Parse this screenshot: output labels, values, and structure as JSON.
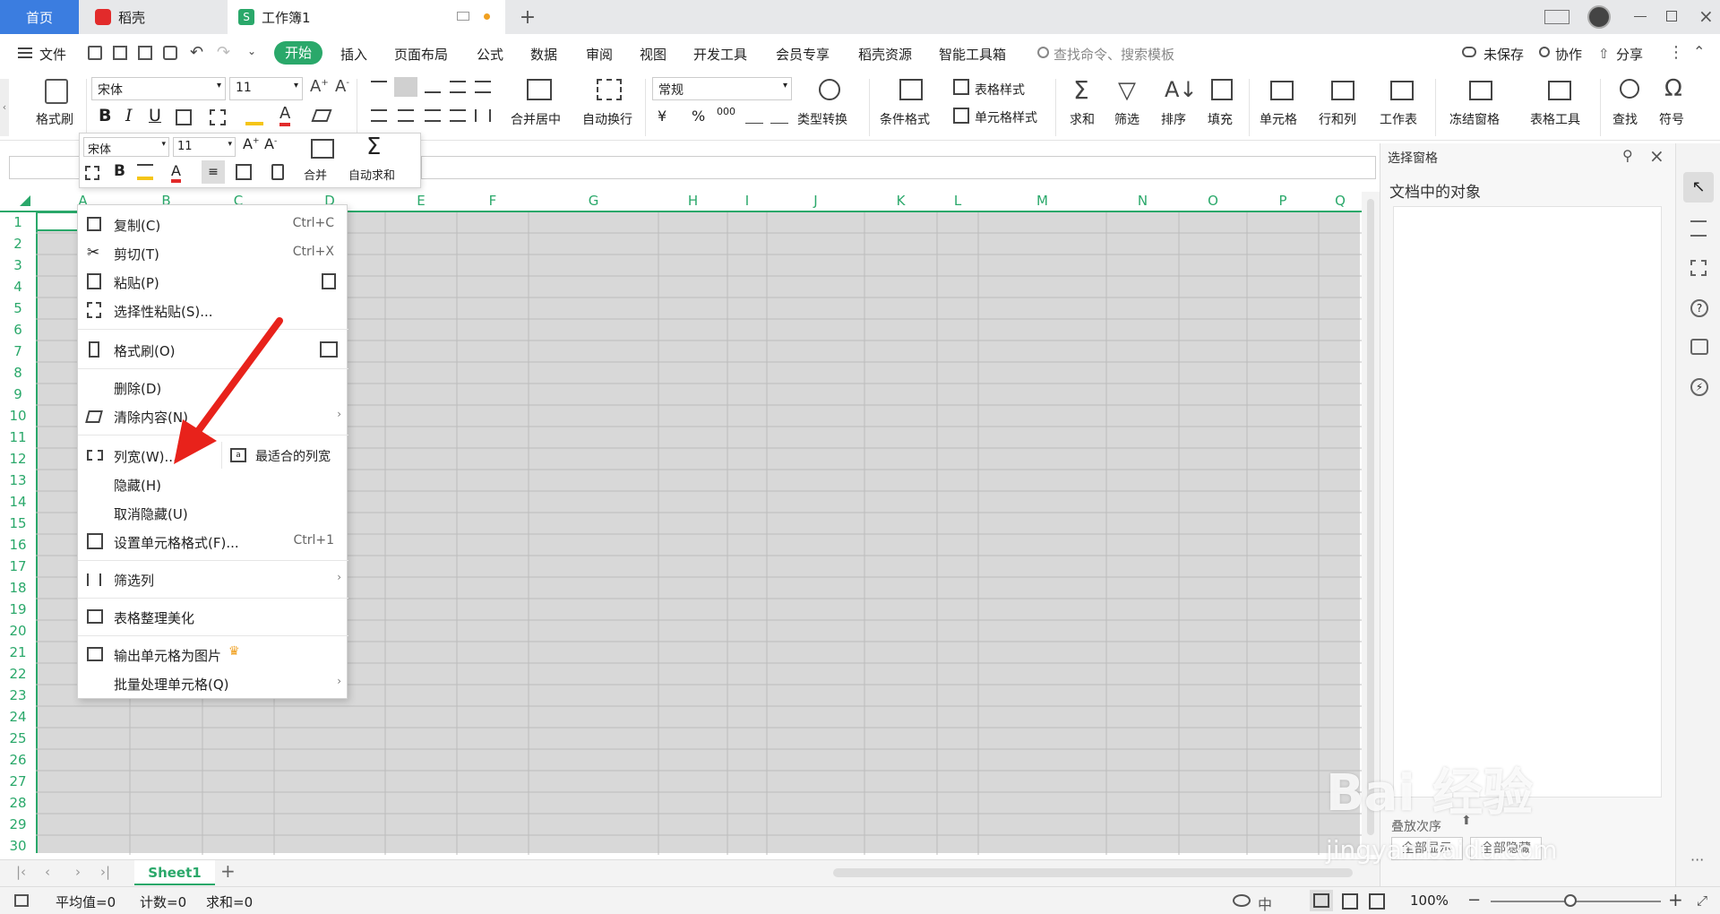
{
  "tabs": {
    "home": "首页",
    "daoke": "稻壳",
    "workbook": "工作簿1"
  },
  "menu": {
    "file": "文件",
    "start": "开始",
    "insert": "插入",
    "layout": "页面布局",
    "formula": "公式",
    "data": "数据",
    "review": "审阅",
    "view": "视图",
    "dev": "开发工具",
    "member": "会员专享",
    "daoke_res": "稻壳资源",
    "smart": "智能工具箱",
    "search": "查找命令、搜索模板",
    "unsaved": "未保存",
    "collab": "协作",
    "share": "分享"
  },
  "ribbon": {
    "brush": "格式刷",
    "font": "宋体",
    "size": "11",
    "merge": "合并居中",
    "wrap": "自动换行",
    "numfmt": "常规",
    "convert": "类型转换",
    "cond": "条件格式",
    "tablestyle": "表格样式",
    "cellstyle": "单元格样式",
    "sum": "求和",
    "filter": "筛选",
    "sort": "排序",
    "fill": "填充",
    "cell": "单元格",
    "rowcol": "行和列",
    "sheet": "工作表",
    "freeze": "冻结窗格",
    "tabletool": "表格工具",
    "find": "查找",
    "symbol": "符号",
    "currency": "¥",
    "percent": "%",
    "thousand": "000"
  },
  "mini": {
    "font": "宋体",
    "size": "11",
    "merge": "合并",
    "autosum": "自动求和"
  },
  "columns": [
    "A",
    "B",
    "C",
    "D",
    "E",
    "F",
    "G",
    "H",
    "I",
    "J",
    "K",
    "L",
    "M",
    "N",
    "O",
    "P",
    "Q"
  ],
  "rows": [
    "1",
    "2",
    "3",
    "4",
    "5",
    "6",
    "7",
    "8",
    "9",
    "10",
    "11",
    "12",
    "13",
    "14",
    "15",
    "16",
    "17",
    "18",
    "19",
    "20",
    "21",
    "22",
    "23",
    "24",
    "25",
    "26",
    "27",
    "28",
    "29",
    "30"
  ],
  "context_menu": {
    "copy": "复制(C)",
    "copy_sc": "Ctrl+C",
    "cut": "剪切(T)",
    "cut_sc": "Ctrl+X",
    "paste": "粘贴(P)",
    "paste_special": "选择性粘贴(S)...",
    "brush": "格式刷(O)",
    "delete": "删除(D)",
    "clear": "清除内容(N)",
    "col_width": "列宽(W)...",
    "best_fit": "最适合的列宽",
    "hide": "隐藏(H)",
    "unhide": "取消隐藏(U)",
    "cell_format": "设置单元格格式(F)...",
    "cell_format_sc": "Ctrl+1",
    "filter_col": "筛选列",
    "beautify": "表格整理美化",
    "export_img": "输出单元格为图片",
    "batch": "批量处理单元格(Q)"
  },
  "right_panel": {
    "title": "选择窗格",
    "subtitle": "文档中的对象",
    "order": "叠放次序",
    "show_all": "全部显示",
    "hide_all": "全部隐藏"
  },
  "sheet": {
    "name": "Sheet1"
  },
  "status": {
    "avg": "平均值=0",
    "count": "计数=0",
    "sum": "求和=0",
    "zoom": "100%"
  },
  "watermark": {
    "text": "Bai 经验",
    "url": "jingyan.baidu.com"
  },
  "colors": {
    "accent": "#2aa86a",
    "selected_gray": "#d8d8d8",
    "arrow": "#e8221b"
  }
}
